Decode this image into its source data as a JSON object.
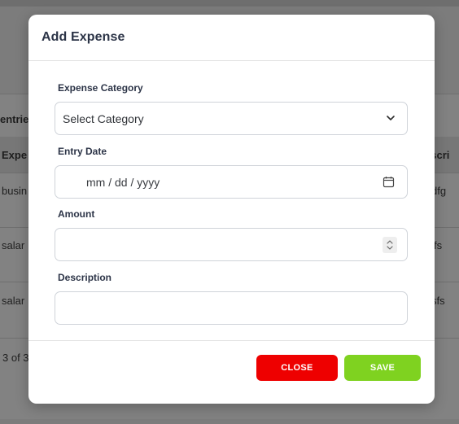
{
  "background": {
    "partial_texts": {
      "entries": "entrie",
      "col_expense": "Expe",
      "col_description": "escri",
      "row1_left": "busin",
      "row1_right": "dfg",
      "row2_left": "salar",
      "row2_right": "fs",
      "row3_left": "salar",
      "row3_right": "sfs",
      "pagination": "3 of 3"
    }
  },
  "modal": {
    "title": "Add Expense",
    "fields": {
      "category": {
        "label": "Expense Category",
        "value": "Select Category"
      },
      "date": {
        "label": "Entry Date",
        "placeholder": "mm / dd / yyyy"
      },
      "amount": {
        "label": "Amount",
        "value": ""
      },
      "description": {
        "label": "Description",
        "value": ""
      }
    },
    "buttons": {
      "close": "CLOSE",
      "save": "SAVE"
    }
  },
  "colors": {
    "close_button": "#ee0000",
    "save_button": "#7fd220",
    "title_text": "#2c3447"
  },
  "icons": {
    "category_dropdown": "chevron-down-icon",
    "date_picker": "calendar-icon",
    "amount_spinner": "spinner-arrows-icon"
  }
}
